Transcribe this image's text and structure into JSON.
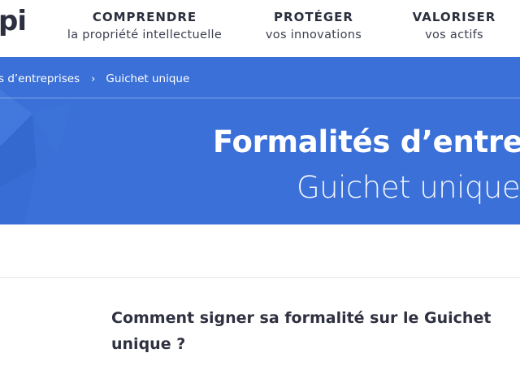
{
  "header": {
    "logo_text": "pi",
    "nav": [
      {
        "title": "COMPRENDRE",
        "subtitle": "la propriété intellectuelle"
      },
      {
        "title": "PROTÉGER",
        "subtitle": "vos innovations"
      },
      {
        "title": "VALORISER",
        "subtitle": "vos actifs"
      }
    ]
  },
  "hero": {
    "breadcrumb": {
      "parent": "s d’entreprises",
      "separator": "›",
      "current": "Guichet unique"
    },
    "title": "Formalités d’entrep",
    "subtitle": "Guichet unique",
    "background_color": "#3a70d8"
  },
  "main": {
    "article_title": "Comment signer sa formalité sur le Guichet unique ?"
  }
}
